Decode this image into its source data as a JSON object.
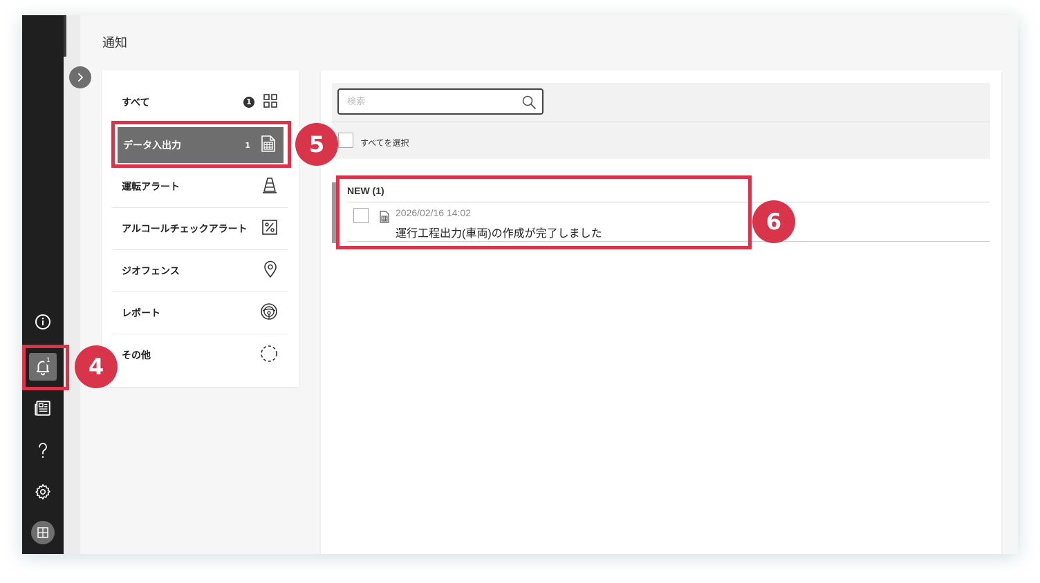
{
  "page": {
    "title": "通知"
  },
  "sidebar": {
    "notification_badge": "1"
  },
  "categories": [
    {
      "label": "すべて",
      "count": "1",
      "icon": "grid-icon"
    },
    {
      "label": "データ入出力",
      "count": "1",
      "icon": "spreadsheet-icon"
    },
    {
      "label": "運転アラート",
      "count": "",
      "icon": "traffic-cone-icon"
    },
    {
      "label": "アルコールチェックアラート",
      "count": "",
      "icon": "percent-icon"
    },
    {
      "label": "ジオフェンス",
      "count": "",
      "icon": "location-pin-icon"
    },
    {
      "label": "レポート",
      "count": "",
      "icon": "steering-wheel-icon"
    },
    {
      "label": "その他",
      "count": "",
      "icon": "dashed-circle-icon"
    }
  ],
  "search": {
    "placeholder": "検索"
  },
  "select_all": {
    "label": "すべてを選択"
  },
  "notifications": {
    "group_label": "NEW (1)",
    "items": [
      {
        "date": "2026/02/16 14:02",
        "message": "運行工程出力(車両)の作成が完了しました"
      }
    ]
  },
  "callouts": [
    "4",
    "5",
    "6"
  ],
  "colors": {
    "highlight": "#d8344a",
    "sidebar_bg": "#1f1f1f",
    "active_item": "#6e6e6e"
  }
}
